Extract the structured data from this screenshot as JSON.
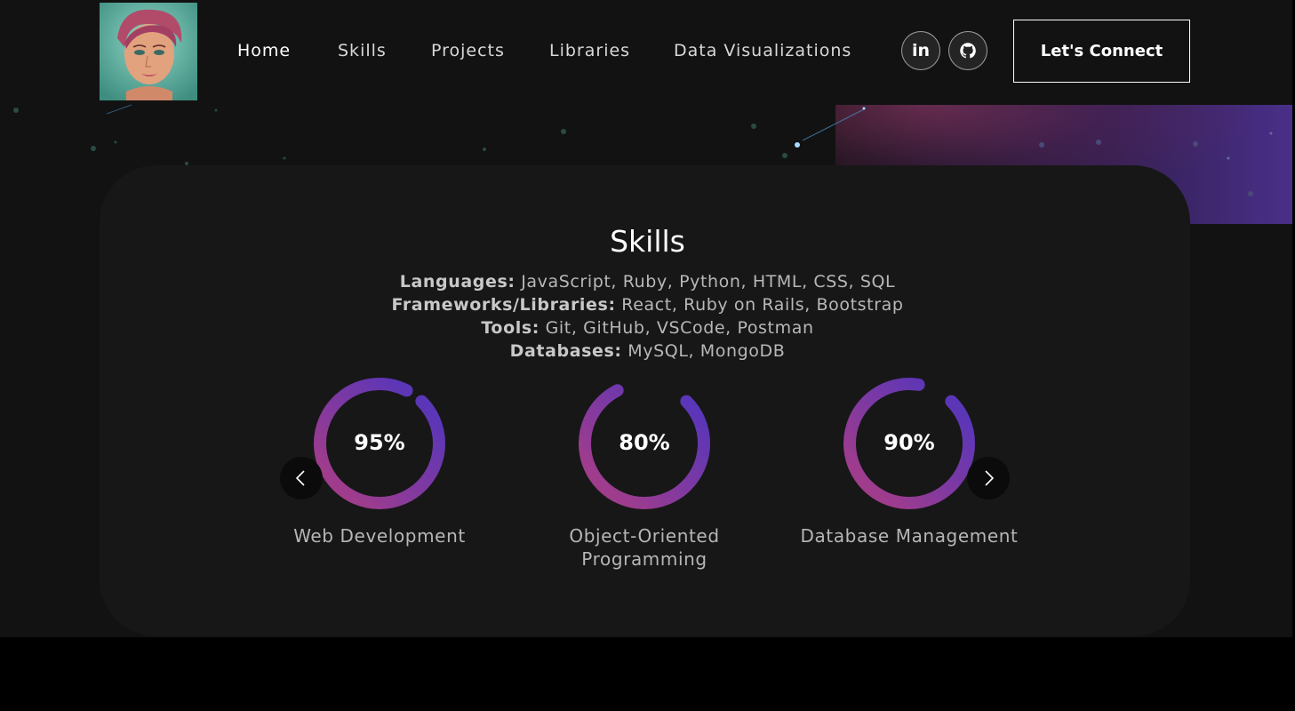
{
  "header": {
    "avatar_alt": "profile avatar",
    "nav": [
      {
        "label": "Home",
        "active": true
      },
      {
        "label": "Skills",
        "active": false
      },
      {
        "label": "Projects",
        "active": false
      },
      {
        "label": "Libraries",
        "active": false
      },
      {
        "label": "Data Visualizations",
        "active": false
      }
    ],
    "social": {
      "linkedin_label": "in"
    },
    "connect_label": "Let's Connect"
  },
  "skills": {
    "title": "Skills",
    "lines": [
      {
        "key": "Languages:",
        "value": "JavaScript, Ruby, Python, HTML, CSS, SQL"
      },
      {
        "key": "Frameworks/Libraries:",
        "value": "React, Ruby on Rails, Bootstrap"
      },
      {
        "key": "Tools:",
        "value": "Git, GitHub, VSCode, Postman"
      },
      {
        "key": "Databases:",
        "value": "MySQL, MongoDB"
      }
    ],
    "gauges": [
      {
        "percent_label": "95%",
        "value": 0.95,
        "label": "Web Development"
      },
      {
        "percent_label": "80%",
        "value": 0.8,
        "label": "Object-Oriented Programming"
      },
      {
        "percent_label": "90%",
        "value": 0.9,
        "label": "Database Management"
      }
    ]
  },
  "colors": {
    "background": "#121212",
    "card": "#171717",
    "gauge_start": "#a03c8c",
    "gauge_end": "#5a36b8"
  },
  "icons": {
    "prev": "chevron-left-icon",
    "next": "chevron-right-icon",
    "linkedin": "linkedin-icon",
    "github": "github-icon"
  }
}
